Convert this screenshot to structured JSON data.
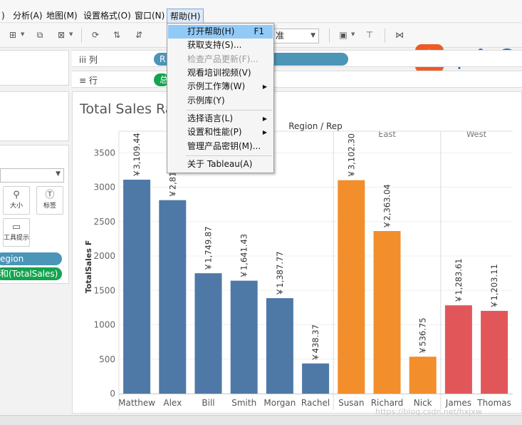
{
  "menubar": {
    "items": [
      {
        "label": ")"
      },
      {
        "label": "分析(A)"
      },
      {
        "label": "地图(M)"
      },
      {
        "label": "设置格式(O)"
      },
      {
        "label": "窗口(N)"
      },
      {
        "label": "帮助(H)"
      }
    ]
  },
  "toolbar": {
    "fit_value": "准",
    "icons": [
      "new-worksheet-icon",
      "duplicate-icon",
      "clear-sheet-icon",
      "group-icon",
      "sort-ascending-icon",
      "sort-descending-icon",
      "show-me-icon",
      "presentation-icon",
      "share-icon"
    ]
  },
  "ime": {
    "logo": "S",
    "char": "中",
    "punct": "°,"
  },
  "shelves": {
    "columns_label": "列",
    "columns_pill": "R",
    "rows_label": "行",
    "rows_pill": "总"
  },
  "marks": {
    "size_label": "大小",
    "label_label": "标签",
    "tooltip_label": "工具提示",
    "pill_region": "egion",
    "pill_sum": "和(TotalSales)"
  },
  "help_menu": {
    "items": [
      {
        "label": "打开帮助(H)",
        "shortcut": "F1",
        "highlight": true
      },
      {
        "label": "获取支持(S)..."
      },
      {
        "label": "检查产品更新(F)...",
        "disabled": true
      },
      {
        "label": "观看培训视频(V)"
      },
      {
        "label": "示例工作簿(W)",
        "submenu": true
      },
      {
        "label": "示例库(Y)"
      },
      {
        "label": "选择语言(L)",
        "submenu": true
      },
      {
        "label": "设置和性能(P)",
        "submenu": true
      },
      {
        "label": "管理产品密钥(M)..."
      },
      {
        "label": "关于 Tableau(A)"
      }
    ]
  },
  "watermark": "https://blog.csdn.net/hxjxw",
  "colors": {
    "central": "#4e79a7",
    "east": "#f28e2b",
    "west": "#e15759",
    "pill_dimension": "#4b95b7",
    "pill_measure": "#14a34f"
  },
  "chart_data": {
    "type": "bar",
    "title": "Total Sales Ra",
    "header": "Region / Rep",
    "ylabel": "TotalSales F",
    "ylim": [
      0,
      3700
    ],
    "yticks": [
      0,
      500,
      1000,
      1500,
      2000,
      2500,
      3000,
      3500
    ],
    "groups": [
      {
        "name": "",
        "color": "#4e79a7",
        "categories": [
          "Matthew",
          "Alex",
          "Bill",
          "Smith",
          "Morgan",
          "Rachel"
        ],
        "values": [
          3109.44,
          2812.19,
          1749.87,
          1641.43,
          1387.77,
          438.37
        ],
        "labels": [
          "￥3,109.44",
          "￥2,812.19",
          "￥1,749.87",
          "￥1,641.43",
          "￥1,387.77",
          "￥438.37"
        ]
      },
      {
        "name": "East",
        "color": "#f28e2b",
        "categories": [
          "Susan",
          "Richard",
          "Nick"
        ],
        "values": [
          3102.3,
          2363.04,
          536.75
        ],
        "labels": [
          "￥3,102.30",
          "￥2,363.04",
          "￥536.75"
        ]
      },
      {
        "name": "West",
        "color": "#e15759",
        "categories": [
          "James",
          "Thomas"
        ],
        "values": [
          1283.61,
          1203.11
        ],
        "labels": [
          "￥1,283.61",
          "￥1,203.11"
        ]
      }
    ]
  }
}
